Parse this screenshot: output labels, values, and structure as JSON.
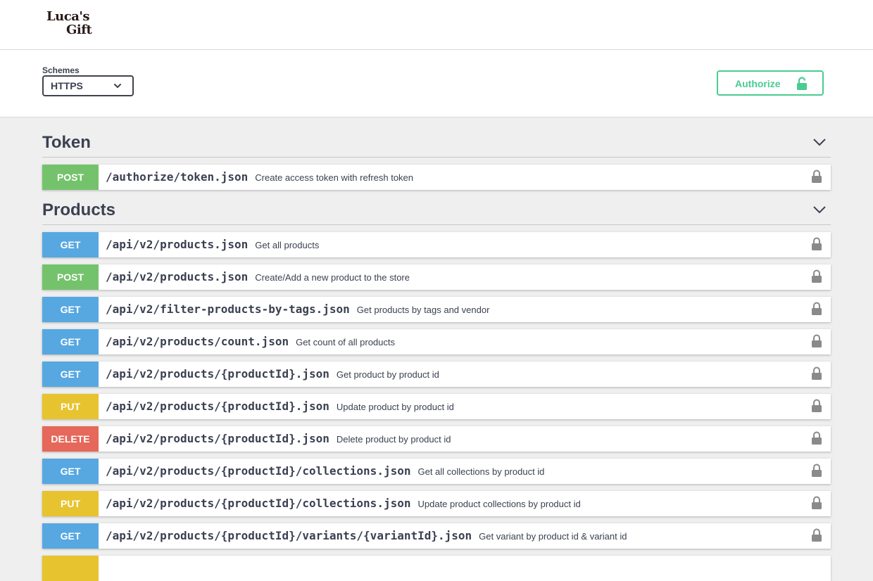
{
  "header": {
    "logo_line1": "Luca's",
    "logo_line2": "Gift"
  },
  "schemes": {
    "label": "Schemes",
    "selected": "HTTPS"
  },
  "authorize": {
    "label": "Authorize"
  },
  "colors": {
    "get": "#57a8e1",
    "post": "#74c36c",
    "put": "#e7c32f",
    "delete": "#e5685a",
    "authorize": "#49cc90"
  },
  "sections": [
    {
      "title": "Token",
      "operations": [
        {
          "method": "POST",
          "path": "/authorize/token.json",
          "summary": "Create access token with refresh token"
        }
      ]
    },
    {
      "title": "Products",
      "operations": [
        {
          "method": "GET",
          "path": "/api/v2/products.json",
          "summary": "Get all products"
        },
        {
          "method": "POST",
          "path": "/api/v2/products.json",
          "summary": "Create/Add a new product to the store"
        },
        {
          "method": "GET",
          "path": "/api/v2/filter-products-by-tags.json",
          "summary": "Get products by tags and vendor"
        },
        {
          "method": "GET",
          "path": "/api/v2/products/count.json",
          "summary": "Get count of all products"
        },
        {
          "method": "GET",
          "path": "/api/v2/products/{productId}.json",
          "summary": "Get product by product id"
        },
        {
          "method": "PUT",
          "path": "/api/v2/products/{productId}.json",
          "summary": "Update product by product id"
        },
        {
          "method": "DELETE",
          "path": "/api/v2/products/{productId}.json",
          "summary": "Delete product by product id"
        },
        {
          "method": "GET",
          "path": "/api/v2/products/{productId}/collections.json",
          "summary": "Get all collections by product id"
        },
        {
          "method": "PUT",
          "path": "/api/v2/products/{productId}/collections.json",
          "summary": "Update product collections by product id"
        },
        {
          "method": "GET",
          "path": "/api/v2/products/{productId}/variants/{variantId}.json",
          "summary": "Get variant by product id & variant id"
        }
      ]
    }
  ]
}
